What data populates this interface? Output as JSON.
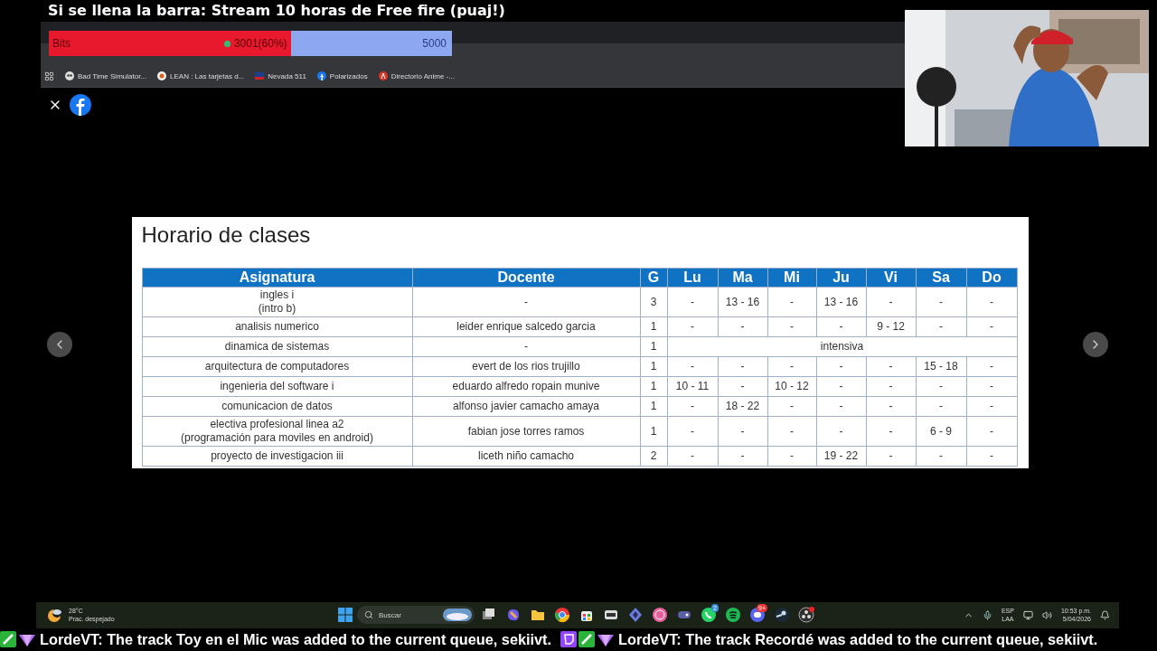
{
  "stream_title": "Si se llena la barra: Stream 10 horas de Free fire (puaj!)",
  "goal_bar": {
    "label": "Bits",
    "current": "3001(60%)",
    "target": "5000",
    "level": 0.6
  },
  "bookmarks": [
    {
      "kind": "skull",
      "label": "Bad Time Simulator..."
    },
    {
      "kind": "lean",
      "label": "LEAN : Las tarjetas d..."
    },
    {
      "kind": "flag",
      "label": "Nevada 511"
    },
    {
      "kind": "facebook",
      "label": "Polarizados"
    },
    {
      "kind": "anime",
      "label": "Directorio Anime -..."
    }
  ],
  "viewer": {
    "title": "Horario de clases",
    "columns": [
      "Asignatura",
      "Docente",
      "G",
      "Lu",
      "Ma",
      "Mi",
      "Ju",
      "Vi",
      "Sa",
      "Do"
    ],
    "rows": [
      {
        "kind": "days",
        "cells": [
          "ingles i\n(intro b)",
          "-",
          "3",
          "-",
          "13 - 16",
          "-",
          "13 - 16",
          "-",
          "-",
          "-"
        ]
      },
      {
        "kind": "days",
        "cells": [
          "analisis numerico",
          "leider enrique salcedo garcia",
          "1",
          "-",
          "-",
          "-",
          "-",
          "9 - 12",
          "-",
          "-"
        ]
      },
      {
        "kind": "merged",
        "cells": [
          "dinamica de sistemas",
          "-",
          "1",
          {
            "text": "intensiva",
            "colspan": 7
          }
        ]
      },
      {
        "kind": "days",
        "cells": [
          "arquitectura de computadores",
          "evert de los rios trujillo",
          "1",
          "-",
          "-",
          "-",
          "-",
          "-",
          "15 - 18",
          "-"
        ]
      },
      {
        "kind": "days",
        "cells": [
          "ingenieria del software i",
          "eduardo alfredo ropain munive",
          "1",
          "10 - 11",
          "-",
          "10 - 12",
          "-",
          "-",
          "-",
          "-"
        ]
      },
      {
        "kind": "days",
        "cells": [
          "comunicacion de datos",
          "alfonso javier camacho amaya",
          "1",
          "-",
          "18 - 22",
          "-",
          "-",
          "-",
          "-",
          "-"
        ]
      },
      {
        "kind": "days",
        "cells": [
          "electiva profesional linea a2\n(programación para moviles en android)",
          "fabian jose torres ramos",
          "1",
          "-",
          "-",
          "-",
          "-",
          "-",
          "6 - 9",
          "-"
        ]
      },
      {
        "kind": "days",
        "cells": [
          "proyecto de investigacion iii",
          "liceth niño camacho",
          "2",
          "-",
          "-",
          "-",
          "19 - 22",
          "-",
          "-",
          "-"
        ]
      }
    ]
  },
  "taskbar": {
    "weather": {
      "temp": "28°C",
      "sky": "Prac. despejado"
    },
    "search": "Buscar",
    "apps": [
      {
        "kind": "task-view"
      },
      {
        "kind": "copilot"
      },
      {
        "kind": "folder"
      },
      {
        "kind": "chrome"
      },
      {
        "kind": "store"
      },
      {
        "kind": "notes"
      },
      {
        "kind": "prism"
      },
      {
        "kind": "pink"
      },
      {
        "kind": "gamepad"
      },
      {
        "kind": "whatsapp",
        "badge": "2"
      },
      {
        "kind": "spotify"
      },
      {
        "kind": "discord",
        "badge": "9+"
      },
      {
        "kind": "steam"
      },
      {
        "kind": "obs"
      }
    ],
    "language": [
      "ESP",
      "LAA"
    ],
    "time": "10:53 p.m.",
    "date": "5/04/2026"
  },
  "ticker": [
    {
      "badges": [
        {
          "kind": "sword"
        },
        {
          "kind": "gem"
        }
      ],
      "text": "LordeVT: The track Toy en el Mic was added to the current queue, sekiivt."
    },
    {
      "badges": [
        {
          "kind": "twitch"
        },
        {
          "kind": "sword"
        },
        {
          "kind": "gem"
        }
      ],
      "text": "LordeVT: The track Recordé was added to the current queue, sekiivt."
    }
  ]
}
